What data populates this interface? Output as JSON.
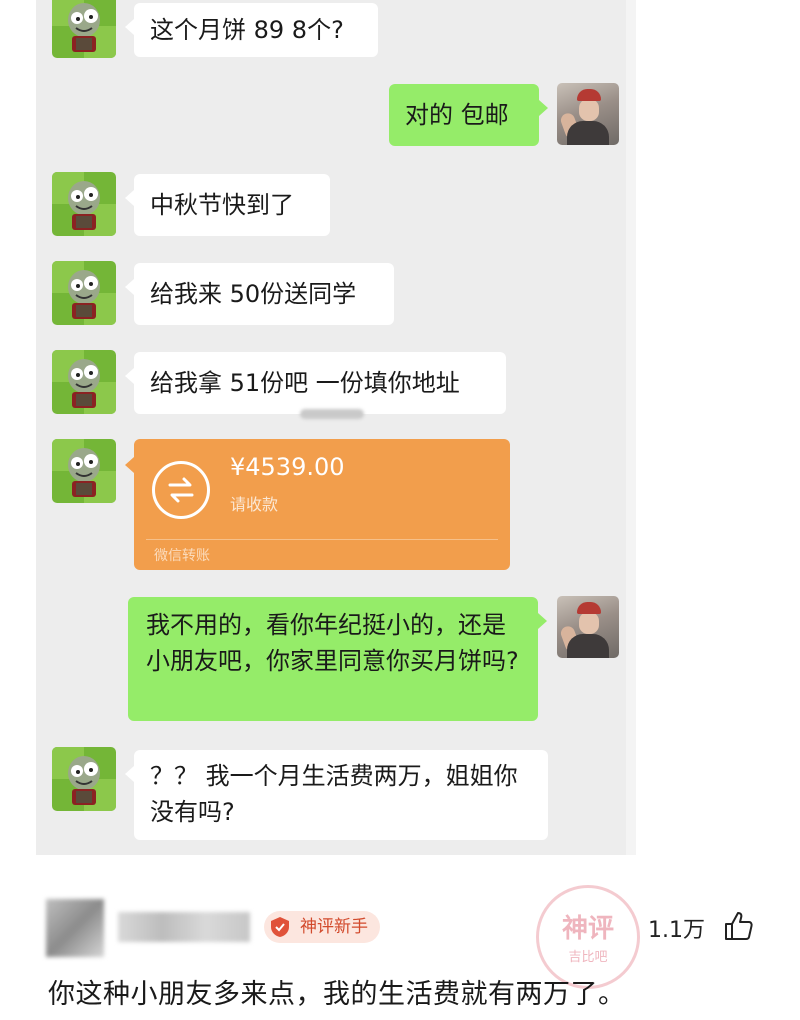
{
  "messages": [
    {
      "side": "left",
      "text": "这个月饼 89 8个?"
    },
    {
      "side": "right",
      "text": "对的 包邮"
    },
    {
      "side": "left",
      "text": "中秋节快到了"
    },
    {
      "side": "left",
      "text": "给我来 50份送同学"
    },
    {
      "side": "left",
      "text": "给我拿 51份吧 一份填你地址"
    },
    {
      "side": "right",
      "text": "我不用的，看你年纪挺小的，还是小朋友吧，你家里同意你买月饼吗?"
    },
    {
      "side": "left",
      "text": "？？ 我一个月生活费两万，姐姐你没有吗?"
    }
  ],
  "transfer": {
    "amount": "¥4539.00",
    "status": "请收款",
    "footer": "微信转账",
    "color": "#f29e4c"
  },
  "comment": {
    "badge": "神评新手",
    "likes": "1.1万",
    "text": "你这种小朋友多来点，我的生活费就有两万了。",
    "stamp_main": "神评",
    "stamp_sub": "吉比吧"
  },
  "icons": {
    "transfer": "transfer-arrows-icon",
    "like": "thumbs-up-icon",
    "badge": "shield-badge-icon"
  },
  "colors": {
    "chat_background": "#ededed",
    "left_bubble": "#ffffff",
    "right_bubble": "#95ec69",
    "badge_text": "#d24a2c"
  }
}
